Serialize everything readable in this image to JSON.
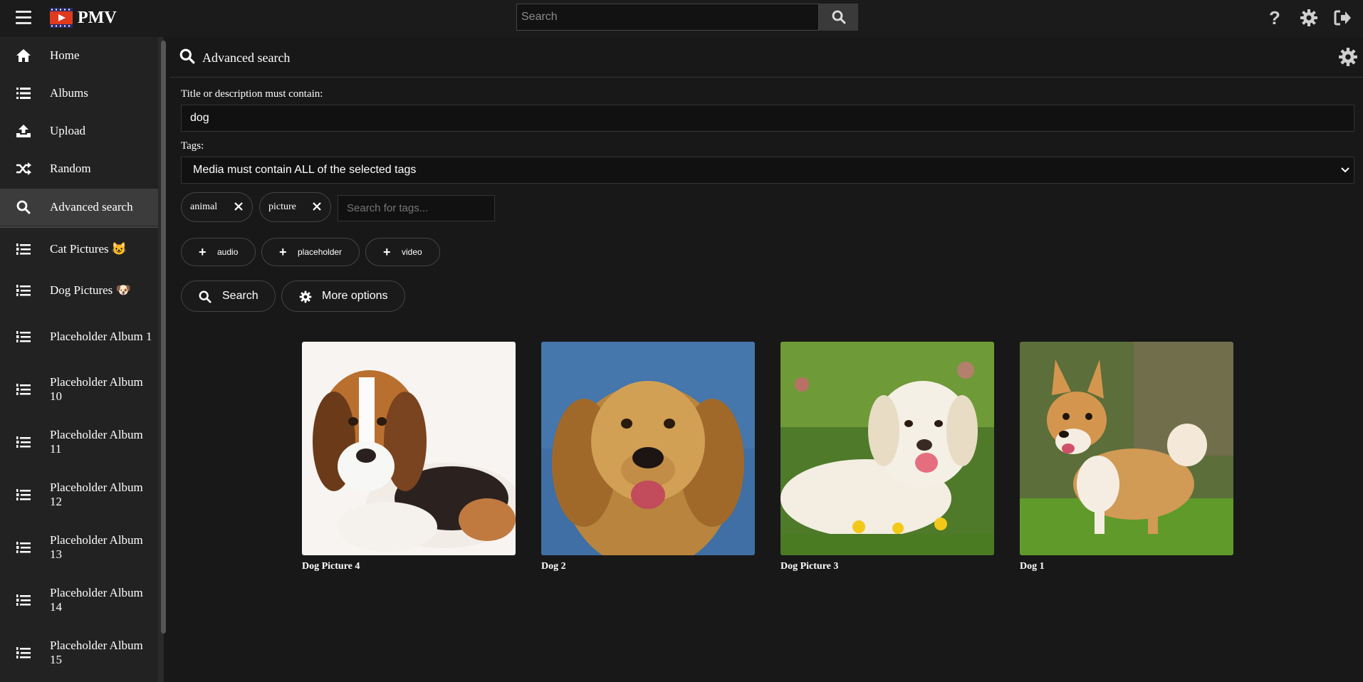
{
  "app": {
    "name": "PMV"
  },
  "topbar": {
    "search_placeholder": "Search",
    "icons": [
      "menu-icon",
      "logo-icon",
      "search-icon",
      "help-icon",
      "gear-icon",
      "logout-icon"
    ]
  },
  "sidebar": {
    "items": [
      {
        "label": "Home",
        "icon": "home-icon"
      },
      {
        "label": "Albums",
        "icon": "list-icon"
      },
      {
        "label": "Upload",
        "icon": "upload-icon"
      },
      {
        "label": "Random",
        "icon": "shuffle-icon"
      },
      {
        "label": "Advanced search",
        "icon": "search-icon",
        "active": true
      }
    ],
    "albums": [
      {
        "label": "Cat Pictures 😺",
        "icon": "album-list-icon"
      },
      {
        "label": "Dog Pictures 🐶",
        "icon": "album-list-icon"
      },
      {
        "label": "Placeholder Album 1",
        "icon": "album-list-icon"
      },
      {
        "label": "Placeholder Album 10",
        "icon": "album-list-icon"
      },
      {
        "label": "Placeholder Album 11",
        "icon": "album-list-icon"
      },
      {
        "label": "Placeholder Album 12",
        "icon": "album-list-icon"
      },
      {
        "label": "Placeholder Album 13",
        "icon": "album-list-icon"
      },
      {
        "label": "Placeholder Album 14",
        "icon": "album-list-icon"
      },
      {
        "label": "Placeholder Album 15",
        "icon": "album-list-icon"
      }
    ]
  },
  "page": {
    "title": "Advanced search",
    "title_label": "Title or description must contain:",
    "title_value": "dog",
    "tags_label": "Tags:",
    "tags_mode": "Media must contain ALL of the selected tags",
    "selected_tags": [
      "animal",
      "picture"
    ],
    "tag_search_placeholder": "Search for tags...",
    "suggested_tags": [
      "audio",
      "placeholder",
      "video"
    ],
    "search_button": "Search",
    "more_options_button": "More options"
  },
  "results": [
    {
      "title": "Dog Picture 4"
    },
    {
      "title": "Dog 2"
    },
    {
      "title": "Dog Picture 3"
    },
    {
      "title": "Dog 1"
    }
  ],
  "colors": {
    "background": "#181818",
    "sidebar": "#222222",
    "active_item": "#3c3c3c",
    "logo_red": "#e03a1e"
  }
}
